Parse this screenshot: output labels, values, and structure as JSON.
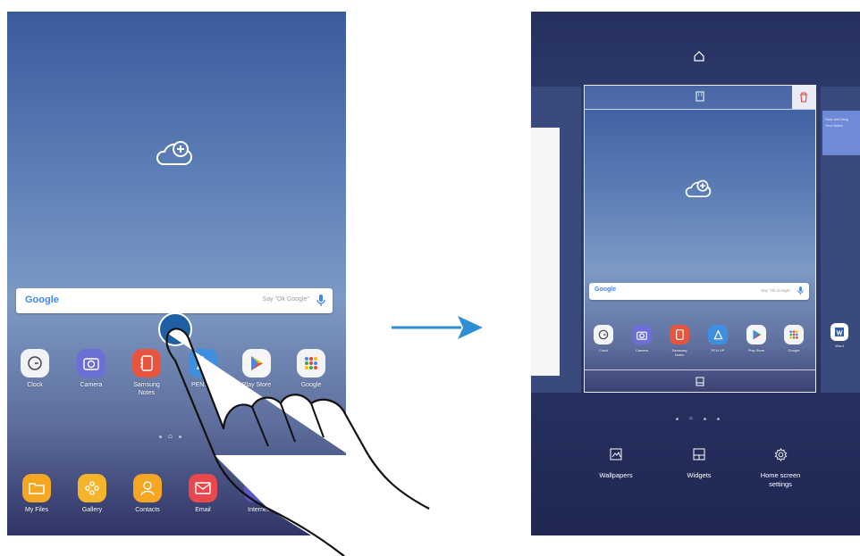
{
  "left_screen": {
    "add_cloud_icon": "cloud-plus-icon",
    "search": {
      "logo": "Google",
      "hint": "Say \"Ok Google\""
    },
    "apps": [
      {
        "label": "Clock",
        "color": "#f1f3f6"
      },
      {
        "label": "Camera",
        "color": "#6b6fd6"
      },
      {
        "label": "Samsung\nNotes",
        "color": "#e8553f"
      },
      {
        "label": "PEN.UP",
        "color": "#3f8fe0"
      },
      {
        "label": "Play Store",
        "color": "#f5f6f8"
      },
      {
        "label": "Google",
        "color": "#f3f3f3"
      }
    ],
    "dock": [
      {
        "label": "My Files",
        "color": "#f5a623"
      },
      {
        "label": "Gallery",
        "color": "#f5b52a"
      },
      {
        "label": "Contacts",
        "color": "#f5a623"
      },
      {
        "label": "Email",
        "color": "#e8484c"
      },
      {
        "label": "Internet",
        "color": "#5a56c6"
      }
    ]
  },
  "right_screen": {
    "home_icon": "home-icon",
    "page_icon": "page-grid-icon",
    "delete_icon": "trash-icon",
    "add_cloud_icon": "cloud-plus-icon",
    "search": {
      "logo": "Google",
      "hint": "Say \"Ok Google\""
    },
    "apps": [
      {
        "label": "Clock",
        "color": "#f1f3f6"
      },
      {
        "label": "Camera",
        "color": "#6b6fd6"
      },
      {
        "label": "Samsung\nNotes",
        "color": "#e8553f"
      },
      {
        "label": "PEN.UP",
        "color": "#3f8fe0"
      },
      {
        "label": "Play Store",
        "color": "#f5f6f8"
      },
      {
        "label": "Google",
        "color": "#f3f3f3"
      }
    ],
    "side_app": {
      "label": "Word",
      "color": "#2f5fb3"
    },
    "next_page_text": "Hold and Drag\nYour Notes",
    "bottom": {
      "wallpapers": "Wallpapers",
      "widgets": "Widgets",
      "settings": "Home screen\nsettings"
    }
  },
  "arrow_color": "#2f8fd4"
}
